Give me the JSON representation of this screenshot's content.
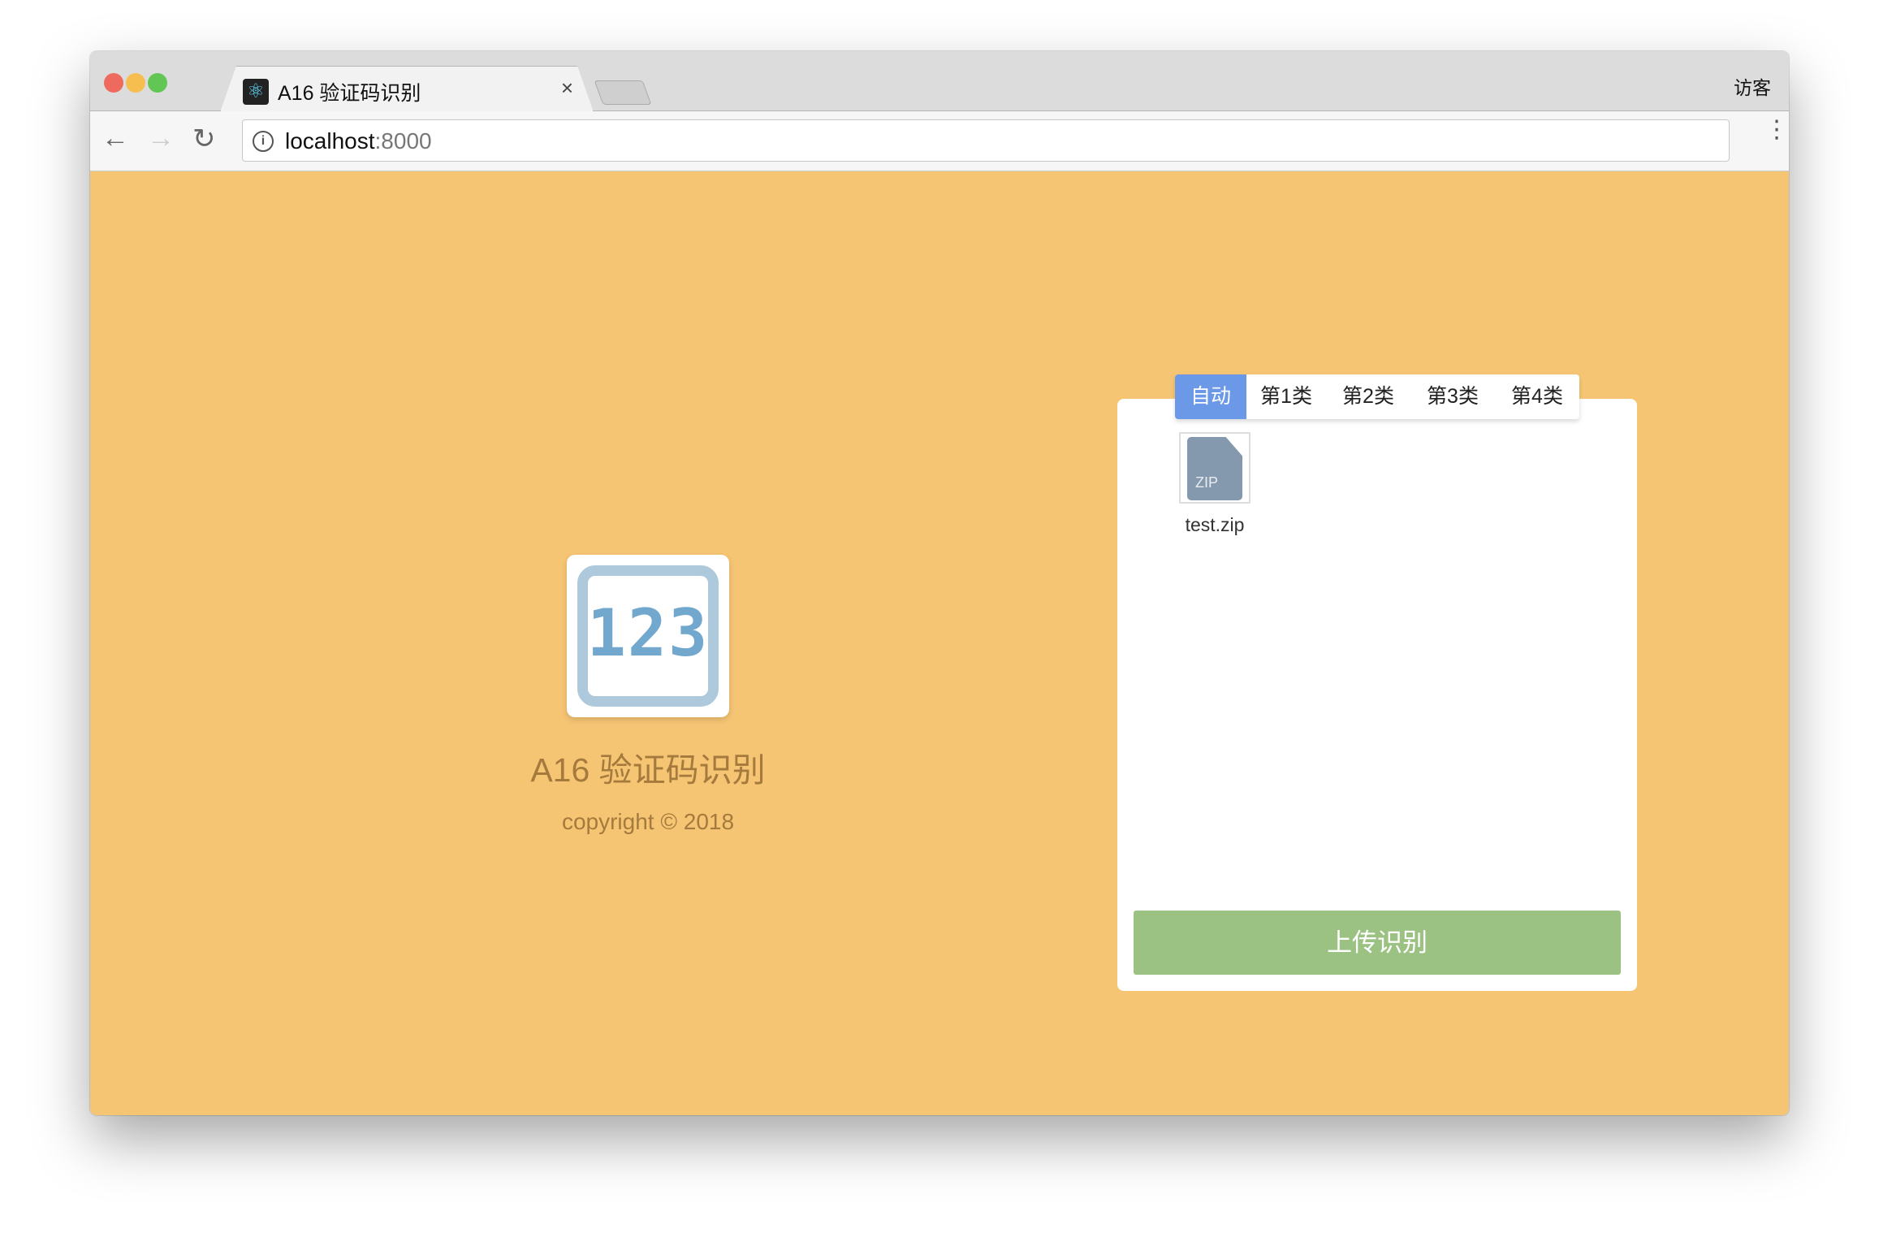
{
  "browser": {
    "tab_title": "A16 验证码识别",
    "close": "×",
    "guest": "访客",
    "url_host": "localhost",
    "url_port": ":8000",
    "back": "←",
    "forward": "→",
    "reload": "↻",
    "menu": "⋮",
    "favicon": "⚛",
    "info": "i"
  },
  "colors": {
    "background": "#f6c574",
    "accent": "#6c98e8",
    "button": "#9cc283"
  },
  "app": {
    "logo_text": "123",
    "title": "A16 验证码识别",
    "copyright": "copyright © 2018"
  },
  "panel": {
    "tabs": [
      {
        "label": "自动",
        "active": true
      },
      {
        "label": "第1类"
      },
      {
        "label": "第2类"
      },
      {
        "label": "第3类"
      },
      {
        "label": "第4类"
      }
    ],
    "file": {
      "type_label": "ZIP",
      "name": "test.zip"
    },
    "upload_label": "上传识别"
  }
}
